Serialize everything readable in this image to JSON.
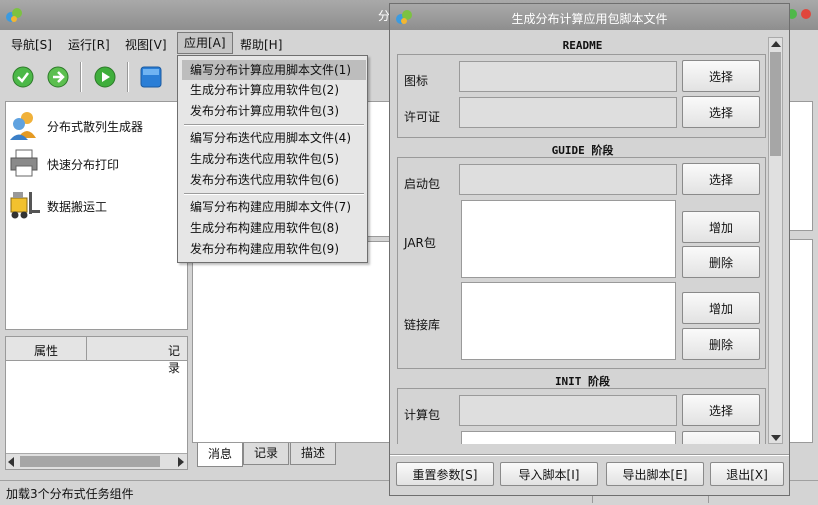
{
  "main_window": {
    "title_fragment": "分",
    "menu": [
      {
        "label": "导航[S]"
      },
      {
        "label": "运行[R]"
      },
      {
        "label": "视图[V]"
      },
      {
        "label": "应用[A]"
      },
      {
        "label": "帮助[H]"
      }
    ],
    "toolbar_icons": [
      "check-icon",
      "forward-icon",
      "play-icon",
      "window-icon"
    ],
    "tree_items": [
      {
        "label": "分布式散列生成器",
        "icon": "users-icon"
      },
      {
        "label": "快速分布打印",
        "icon": "printer-icon"
      },
      {
        "label": "数据搬运工",
        "icon": "forklift-icon"
      }
    ],
    "properties": {
      "col1": "属性",
      "col2": "记录"
    },
    "bottom_tabs": [
      {
        "label": "消息"
      },
      {
        "label": "记录"
      },
      {
        "label": "描述"
      }
    ],
    "status_text": "加载3个分布式任务组件"
  },
  "app_menu": {
    "items": [
      {
        "label": "编写分布计算应用脚本文件(1)"
      },
      {
        "label": "生成分布计算应用软件包(2)"
      },
      {
        "label": "发布分布计算应用软件包(3)"
      },
      {
        "label": "编写分布迭代应用脚本文件(4)"
      },
      {
        "label": "生成分布迭代应用软件包(5)"
      },
      {
        "label": "发布分布迭代应用软件包(6)"
      },
      {
        "label": "编写分布构建应用脚本文件(7)"
      },
      {
        "label": "生成分布构建应用软件包(8)"
      },
      {
        "label": "发布分布构建应用软件包(9)"
      }
    ]
  },
  "dialog": {
    "title": "生成分布计算应用包脚本文件",
    "readme": {
      "header": "README",
      "icon_label": "图标",
      "license_label": "许可证",
      "select": "选择"
    },
    "guide": {
      "header": "GUIDE 阶段",
      "boot_label": "启动包",
      "jar_label": "JAR包",
      "lib_label": "链接库",
      "select": "选择",
      "add": "增加",
      "delete": "删除"
    },
    "init": {
      "header": "INIT 阶段",
      "calc_label": "计算包",
      "select": "选择"
    },
    "buttons": {
      "reset": "重置参数[S]",
      "import": "导入脚本[I]",
      "export": "导出脚本[E]",
      "exit": "退出[X]"
    }
  }
}
